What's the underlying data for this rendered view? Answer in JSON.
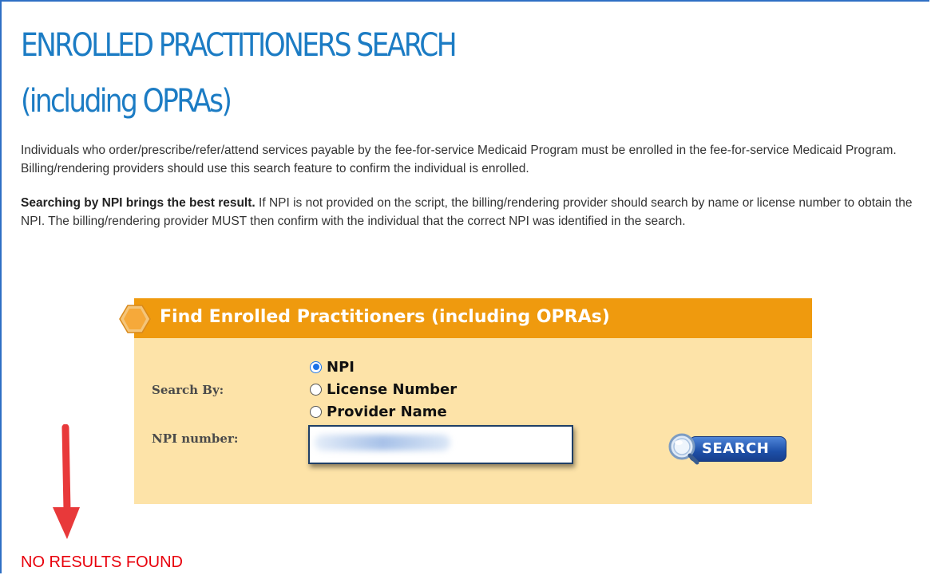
{
  "page": {
    "title_line1": "ENROLLED PRACTITIONERS SEARCH",
    "title_line2": "(including OPRAs)",
    "intro": "Individuals who order/prescribe/refer/attend services payable by the fee-for-service Medicaid Program must be enrolled in the fee-for-service Medicaid Program. Billing/rendering providers should use this search feature to confirm the individual is enrolled.",
    "tip_bold": "Searching by NPI brings the best result.",
    "tip_text": " If NPI is not provided on the script, the billing/rendering provider should search by name or license number to obtain the NPI. The billing/rendering provider MUST then confirm with the individual that the correct NPI was identified in the search."
  },
  "search_panel": {
    "title": "Find Enrolled Practitioners (including OPRAs)",
    "search_by_label": "Search By:",
    "options": [
      {
        "label": "NPI",
        "checked": true
      },
      {
        "label": "License Number",
        "checked": false
      },
      {
        "label": "Provider Name",
        "checked": false
      }
    ],
    "npi_label": "NPI number:",
    "npi_value": "",
    "search_button": "SEARCH"
  },
  "result": {
    "message": "NO RESULTS FOUND"
  },
  "colors": {
    "title": "#1c7cc4",
    "panel_header": "#ef9a0e",
    "panel_body": "#fde3a8",
    "no_results": "#e8000b",
    "annotation_arrow": "#e8393a"
  },
  "icons": [
    "hexagon-icon",
    "magnifier-icon",
    "down-arrow-icon"
  ]
}
